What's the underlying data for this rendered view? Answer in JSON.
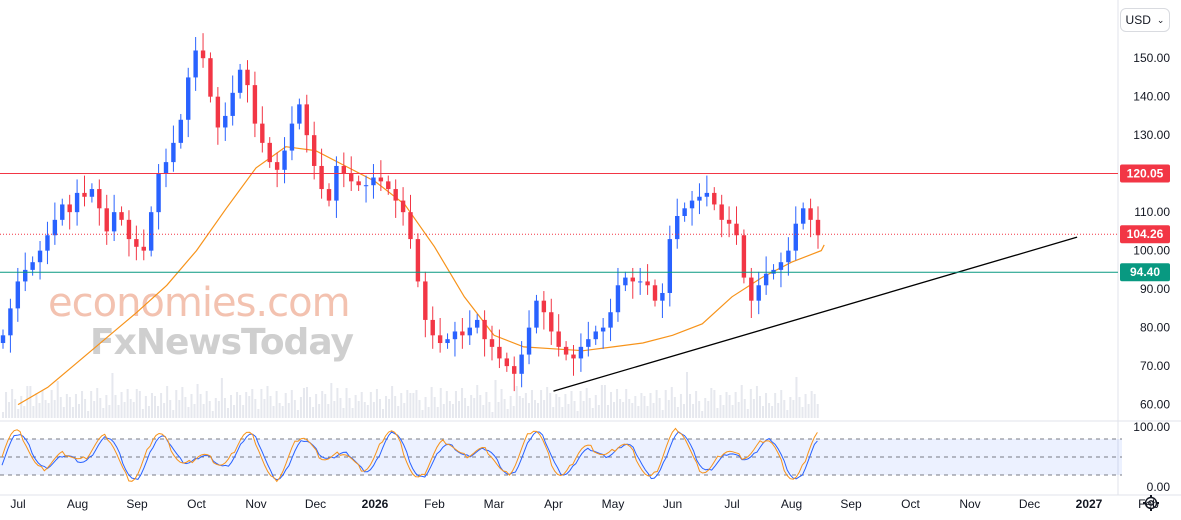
{
  "ui": {
    "currency_label": "USD",
    "currency_icon": "chevron-down-icon",
    "settings_icon": "gear-icon",
    "watermark_line1": "economies.com",
    "watermark_line2": "FxNewsToday"
  },
  "chart_data": {
    "type": "candlestick",
    "price_axis": {
      "ticks": [
        {
          "label": "150.00",
          "value": 150
        },
        {
          "label": "140.00",
          "value": 140
        },
        {
          "label": "130.00",
          "value": 130
        },
        {
          "label": "110.00",
          "value": 110
        },
        {
          "label": "100.00",
          "value": 100
        },
        {
          "label": "90.00",
          "value": 90
        },
        {
          "label": "80.00",
          "value": 80
        },
        {
          "label": "70.00",
          "value": 70
        },
        {
          "label": "60.00",
          "value": 60
        }
      ],
      "range": [
        56,
        162
      ]
    },
    "time_axis": {
      "ticks": [
        {
          "label": "Jul",
          "bold": false
        },
        {
          "label": "Aug",
          "bold": false
        },
        {
          "label": "Sep",
          "bold": false
        },
        {
          "label": "Oct",
          "bold": false
        },
        {
          "label": "Nov",
          "bold": false
        },
        {
          "label": "Dec",
          "bold": false
        },
        {
          "label": "2026",
          "bold": true
        },
        {
          "label": "Feb",
          "bold": false
        },
        {
          "label": "Mar",
          "bold": false
        },
        {
          "label": "Apr",
          "bold": false
        },
        {
          "label": "May",
          "bold": false
        },
        {
          "label": "Jun",
          "bold": false
        },
        {
          "label": "Jul",
          "bold": false
        },
        {
          "label": "Aug",
          "bold": false
        },
        {
          "label": "Sep",
          "bold": false
        },
        {
          "label": "Oct",
          "bold": false
        },
        {
          "label": "Nov",
          "bold": false
        },
        {
          "label": "Dec",
          "bold": false
        },
        {
          "label": "2027",
          "bold": true
        },
        {
          "label": "Feb",
          "bold": false
        }
      ]
    },
    "horizontal_levels": [
      {
        "label": "120.05",
        "value": 120.05,
        "color": "#f23645",
        "style": "solid"
      },
      {
        "label": "104.26",
        "value": 104.26,
        "color": "#f23645",
        "style": "dotted"
      },
      {
        "label": "94.40",
        "value": 94.4,
        "color": "#089981",
        "style": "solid"
      }
    ],
    "trendline": {
      "from": {
        "month_index": 9,
        "value": 63.5
      },
      "to": {
        "month_index": 17.8,
        "value": 103.5
      },
      "color": "#000000"
    },
    "moving_average": {
      "color": "#f7931a",
      "points": [
        [
          0,
          60
        ],
        [
          0.5,
          64.5
        ],
        [
          1,
          71
        ],
        [
          1.5,
          77.5
        ],
        [
          2,
          84
        ],
        [
          2.5,
          91
        ],
        [
          3,
          100
        ],
        [
          3.5,
          111
        ],
        [
          4,
          121.5
        ],
        [
          4.5,
          127
        ],
        [
          5,
          126
        ],
        [
          5.5,
          122
        ],
        [
          6,
          118
        ],
        [
          6.5,
          112
        ],
        [
          7,
          101
        ],
        [
          7.5,
          88
        ],
        [
          8,
          78
        ],
        [
          8.5,
          75
        ],
        [
          9,
          74.5
        ],
        [
          9.5,
          74
        ],
        [
          10,
          75
        ],
        [
          10.5,
          76
        ],
        [
          11,
          78
        ],
        [
          11.5,
          81
        ],
        [
          12,
          88
        ],
        [
          12.5,
          93
        ],
        [
          13,
          97
        ],
        [
          13.5,
          100
        ],
        [
          13.55,
          101.5
        ]
      ]
    },
    "candles": {
      "up_color": "#2962ff",
      "down_color": "#f23645",
      "closes": [
        78,
        85,
        92,
        95,
        97,
        100,
        104,
        108,
        112,
        110,
        115,
        114,
        116,
        111,
        105,
        110,
        108,
        103,
        101,
        100,
        110,
        120,
        123,
        128,
        134,
        145,
        152,
        150,
        140,
        132,
        135,
        141,
        147,
        143,
        133,
        128,
        123,
        121,
        126,
        133,
        138,
        130,
        122,
        116,
        113,
        122,
        120,
        118,
        117,
        117,
        119,
        118,
        116,
        113,
        110,
        103,
        92,
        82,
        78,
        76,
        77,
        79,
        78,
        80,
        82,
        77,
        75,
        72,
        70,
        68,
        73,
        80,
        87,
        84,
        79,
        75,
        73,
        72,
        75,
        77,
        79,
        80,
        84,
        91,
        93,
        92,
        92,
        91,
        87,
        89,
        103,
        109,
        111,
        113,
        114,
        115,
        112,
        108,
        107,
        104,
        93,
        87,
        91,
        94,
        95,
        97,
        100,
        107,
        111,
        108,
        104
      ]
    },
    "stochastic": {
      "scale": {
        "ticks": [
          {
            "label": "100.00",
            "value": 100
          },
          {
            "label": "0.00",
            "value": 0
          }
        ],
        "range": [
          0,
          100
        ]
      },
      "band": {
        "upper": 80,
        "mid": 50,
        "lower": 20
      },
      "k_color": "#f7931a",
      "d_color": "#2962ff"
    }
  }
}
